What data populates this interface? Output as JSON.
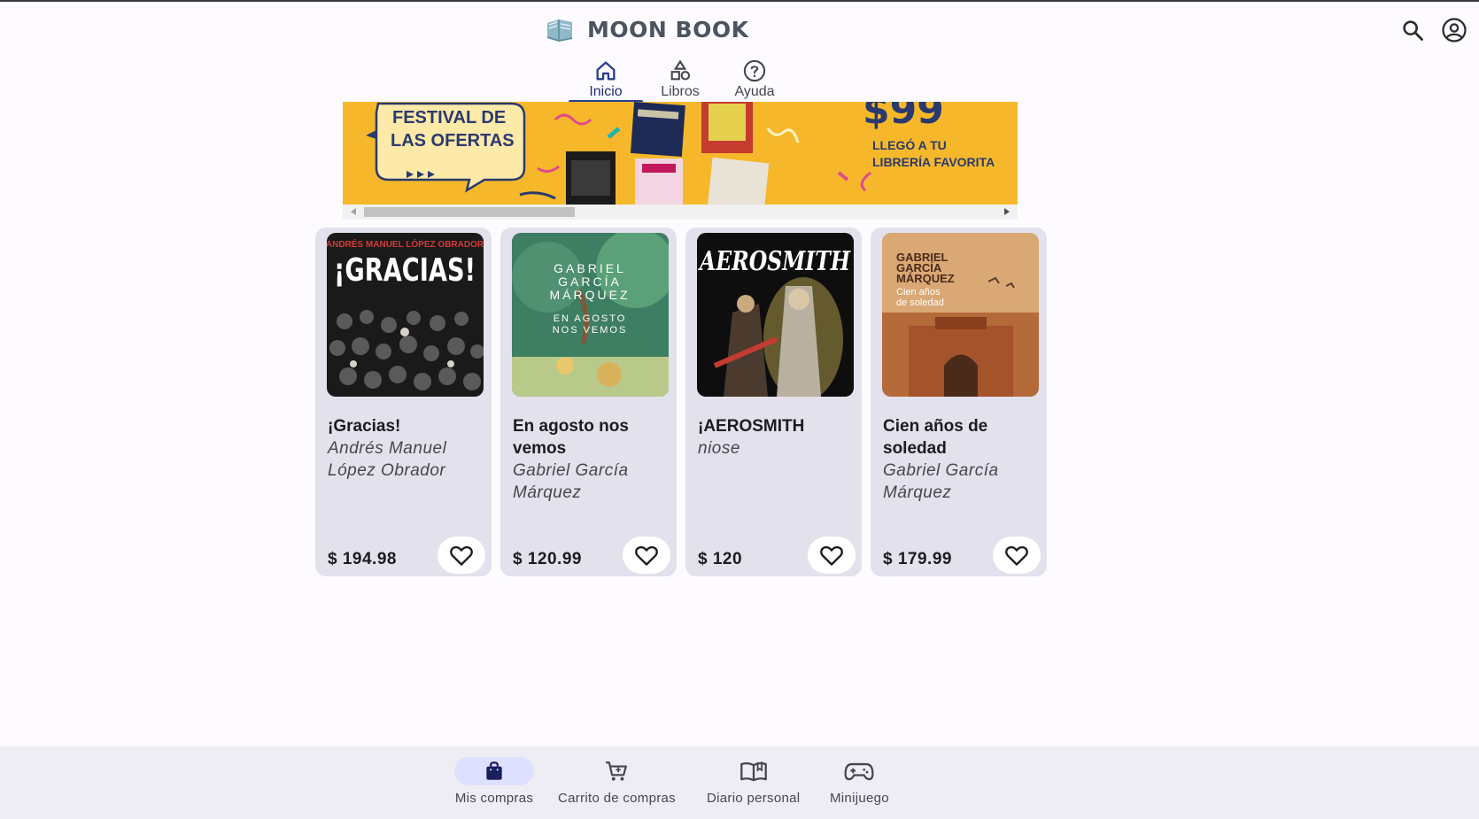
{
  "app": {
    "name": "MOON BOOK"
  },
  "header": {
    "search_icon": "search-icon",
    "account_icon": "account-circle-icon"
  },
  "tabs": [
    {
      "label": "Inicio",
      "icon": "home-icon",
      "active": true
    },
    {
      "label": "Libros",
      "icon": "shapes-icon",
      "active": false
    },
    {
      "label": "Ayuda",
      "icon": "help-circle-icon",
      "active": false
    }
  ],
  "banner": {
    "headline_line1": "FESTIVAL DE",
    "headline_line2": "LAS OFERTAS",
    "price": "$99",
    "tagline_line1": "LLEGÓ A TU",
    "tagline_line2": "LIBRERÍA FAVORITA",
    "colors": {
      "background": "#f6b82a",
      "bubble": "#fde9a8",
      "text": "#2a3a6e"
    }
  },
  "books": [
    {
      "title": "¡Gracias!",
      "author": "Andrés Manuel López Obrador",
      "price": "$ 194.98",
      "cover_header": "ANDRÉS MANUEL LÓPEZ OBRADOR",
      "cover_title": "¡GRACIAS!"
    },
    {
      "title": "En agosto nos vemos",
      "author": "Gabriel García Márquez",
      "price": "$ 120.99",
      "cover_line1": "GABRIEL",
      "cover_line2": "GARCÍA",
      "cover_line3": "MÁRQUEZ",
      "cover_title1": "EN AGOSTO",
      "cover_title2": "NOS VEMOS"
    },
    {
      "title": "¡AEROSMITH",
      "author": "niose",
      "price": "$ 120",
      "cover_title": "AEROSMITH"
    },
    {
      "title": "Cien años de soledad",
      "author": "Gabriel García Márquez",
      "price": "$ 179.99",
      "cover_line1": "GABRIEL",
      "cover_line2": "GARCÍA",
      "cover_line3": "MÁRQUEZ",
      "cover_title1": "Cien años",
      "cover_title2": "de soledad"
    }
  ],
  "bottom_nav": [
    {
      "label": "Mis compras",
      "icon": "shopping-bag-icon",
      "active": true
    },
    {
      "label": "Carrito de compras",
      "icon": "shopping-cart-icon",
      "active": false
    },
    {
      "label": "Diario personal",
      "icon": "book-open-icon",
      "active": false
    },
    {
      "label": "Minijuego",
      "icon": "gamepad-icon",
      "active": false
    }
  ],
  "colors": {
    "accent": "#2a3f8f",
    "active_pill": "#dde1ff",
    "card": "#e3e1ec",
    "bottom_bar": "#efedf4"
  }
}
